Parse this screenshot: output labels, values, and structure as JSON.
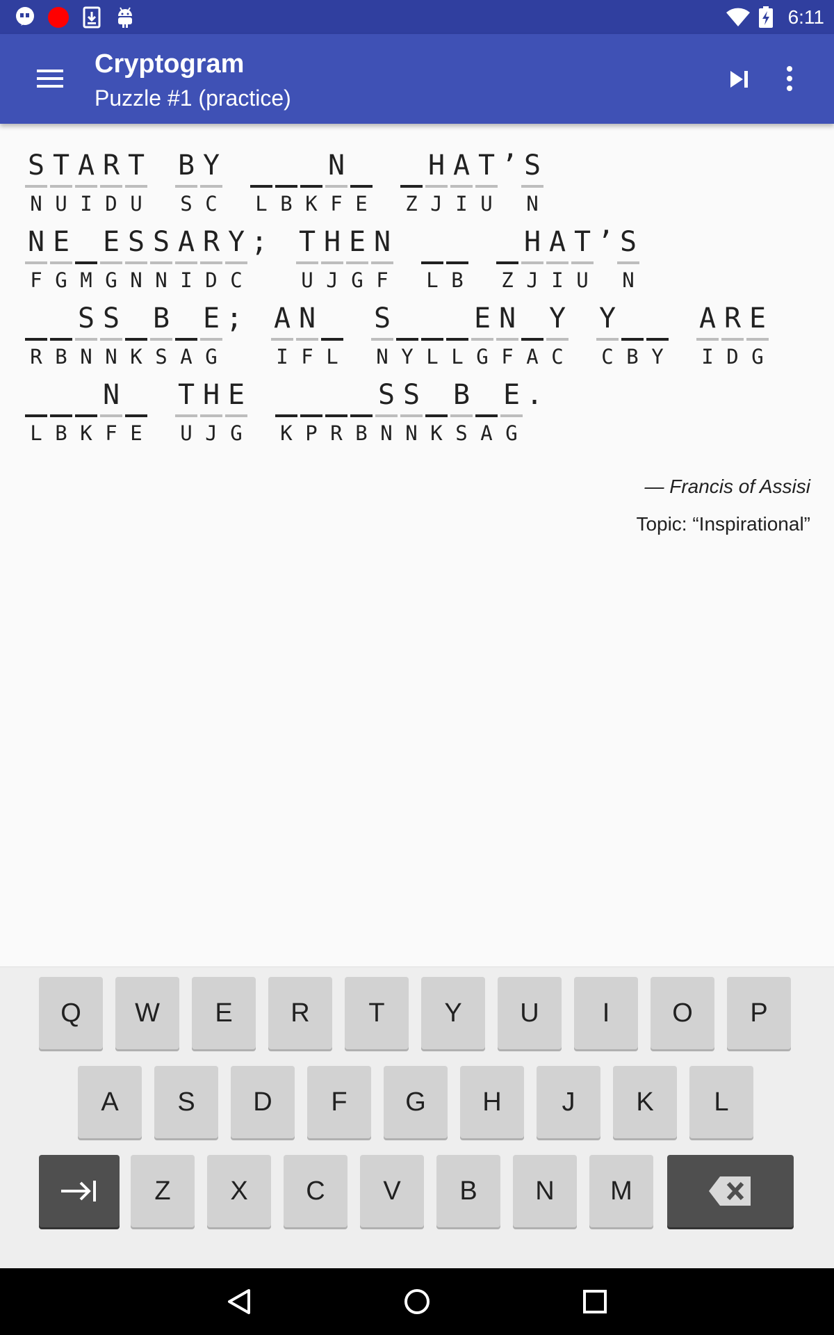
{
  "status_bar": {
    "time": "6:11",
    "icons_left": [
      "hangouts-icon",
      "record-icon",
      "download-icon",
      "android-icon"
    ],
    "icons_right": [
      "wifi-icon",
      "battery-charging-icon"
    ]
  },
  "app_bar": {
    "title": "Cryptogram",
    "subtitle": "Puzzle #1 (practice)",
    "actions": [
      "menu-icon",
      "skip-next-icon",
      "more-vert-icon"
    ]
  },
  "puzzle": {
    "lines": [
      [
        [
          [
            "S",
            "N"
          ],
          [
            "T",
            "U"
          ],
          [
            "A",
            "I"
          ],
          [
            "R",
            "D"
          ],
          [
            "T",
            "U"
          ]
        ],
        [
          [
            "B",
            "S"
          ],
          [
            "Y",
            "C"
          ]
        ],
        [
          [
            "",
            "L"
          ],
          [
            "",
            "B"
          ],
          [
            "",
            "K"
          ],
          [
            "N",
            "F"
          ],
          [
            "",
            "E"
          ]
        ],
        [
          [
            "",
            "Z"
          ],
          [
            "H",
            "J"
          ],
          [
            "A",
            "I"
          ],
          [
            "T",
            "U"
          ],
          [
            "’",
            ""
          ],
          [
            "S",
            "N"
          ]
        ]
      ],
      [
        [
          [
            "N",
            "F"
          ],
          [
            "E",
            "G"
          ],
          [
            "",
            "M"
          ],
          [
            "E",
            "G"
          ],
          [
            "S",
            "N"
          ],
          [
            "S",
            "N"
          ],
          [
            "A",
            "I"
          ],
          [
            "R",
            "D"
          ],
          [
            "Y",
            "C"
          ],
          [
            ";",
            ""
          ]
        ],
        [
          [
            "T",
            "U"
          ],
          [
            "H",
            "J"
          ],
          [
            "E",
            "G"
          ],
          [
            "N",
            "F"
          ]
        ],
        [
          [
            "",
            "L"
          ],
          [
            "",
            "B"
          ]
        ],
        [
          [
            "",
            "Z"
          ],
          [
            "H",
            "J"
          ],
          [
            "A",
            "I"
          ],
          [
            "T",
            "U"
          ],
          [
            "’",
            ""
          ],
          [
            "S",
            "N"
          ]
        ]
      ],
      [
        [
          [
            "",
            "R"
          ],
          [
            "",
            "B"
          ],
          [
            "S",
            "N"
          ],
          [
            "S",
            "N"
          ],
          [
            "",
            "K"
          ],
          [
            "B",
            "S"
          ],
          [
            "",
            "A"
          ],
          [
            "E",
            "G"
          ],
          [
            ";",
            ""
          ]
        ],
        [
          [
            "A",
            "I"
          ],
          [
            "N",
            "F"
          ],
          [
            "",
            "L"
          ]
        ],
        [
          [
            "S",
            "N"
          ],
          [
            "",
            "Y"
          ],
          [
            "",
            "L"
          ],
          [
            "",
            "L"
          ],
          [
            "E",
            "G"
          ],
          [
            "N",
            "F"
          ],
          [
            "",
            "A"
          ],
          [
            "Y",
            "C"
          ]
        ],
        [
          [
            "Y",
            "C"
          ],
          [
            "",
            "B"
          ],
          [
            "",
            "Y"
          ]
        ],
        [
          [
            "A",
            "I"
          ],
          [
            "R",
            "D"
          ],
          [
            "E",
            "G"
          ]
        ]
      ],
      [
        [
          [
            "",
            "L"
          ],
          [
            "",
            "B"
          ],
          [
            "",
            "K"
          ],
          [
            "N",
            "F"
          ],
          [
            "",
            "E"
          ]
        ],
        [
          [
            "T",
            "U"
          ],
          [
            "H",
            "J"
          ],
          [
            "E",
            "G"
          ]
        ],
        [
          [
            "",
            "K"
          ],
          [
            "",
            "P"
          ],
          [
            "",
            "R"
          ],
          [
            "",
            "B"
          ],
          [
            "S",
            "N"
          ],
          [
            "S",
            "N"
          ],
          [
            "",
            "K"
          ],
          [
            "B",
            "S"
          ],
          [
            "",
            "A"
          ],
          [
            "E",
            "G"
          ],
          [
            ".",
            ""
          ]
        ]
      ]
    ],
    "author": "— Francis of Assisi",
    "topic": "Topic: “Inspirational”"
  },
  "keyboard": {
    "row1": [
      "Q",
      "W",
      "E",
      "R",
      "T",
      "Y",
      "U",
      "I",
      "O",
      "P"
    ],
    "row2": [
      "A",
      "S",
      "D",
      "F",
      "G",
      "H",
      "J",
      "K",
      "L"
    ],
    "row3": [
      "Z",
      "X",
      "C",
      "V",
      "B",
      "N",
      "M"
    ],
    "special": [
      "tab-right-icon",
      "backspace-icon"
    ]
  },
  "nav_bar": {
    "buttons": [
      "back-icon",
      "home-icon",
      "recents-icon"
    ]
  },
  "colors": {
    "status_bar": "#303f9f",
    "app_bar": "#3f51b5",
    "key": "#d2d2d2",
    "key_dark": "#4f4f4f"
  }
}
